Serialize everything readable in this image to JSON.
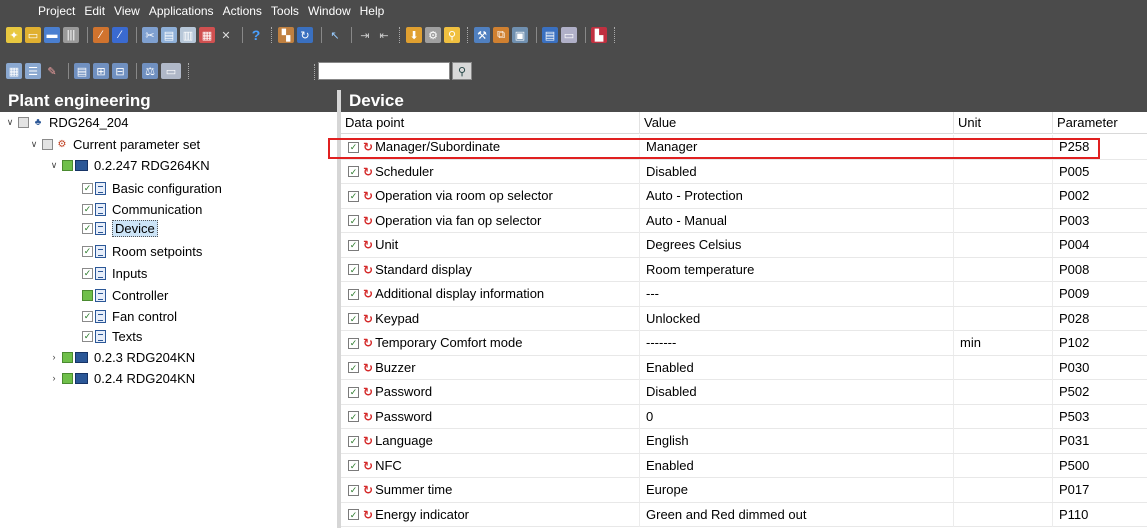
{
  "menu": [
    "Project",
    "Edit",
    "View",
    "Applications",
    "Actions",
    "Tools",
    "Window",
    "Help"
  ],
  "toolbar": {
    "search_value": "",
    "row1_icons": [
      "new-project-icon",
      "open-project-icon",
      "save-icon",
      "print-icon",
      "wand-icon",
      "edit-icon",
      "cut-icon",
      "copy-icon",
      "paste-icon",
      "paste-special-icon",
      "delete-icon",
      "help-icon",
      "view-icon",
      "refresh-icon",
      "connect-icon",
      "export-icon",
      "import-icon",
      "download-icon",
      "settings-icon",
      "search-icon",
      "tools-icon",
      "network-icon",
      "device-icon",
      "report-icon",
      "list-icon",
      "monitor-icon"
    ],
    "row2_icons": [
      "grid-icon",
      "list-view-icon",
      "pen-icon",
      "align-icon",
      "tree-icon",
      "hierarchy-icon",
      "scale-icon",
      "zone-icon"
    ],
    "search_icon": "magnifier-icon"
  },
  "left_pane": {
    "title": "Plant engineering",
    "tree": [
      {
        "label": "RDG264_204",
        "level": 0,
        "expanded": true,
        "icon": "plant-icon"
      },
      {
        "label": "Current parameter set",
        "level": 1,
        "expanded": true,
        "icon": "parameter-set-icon"
      },
      {
        "label": "0.2.247  RDG264KN",
        "level": 2,
        "expanded": true,
        "icon": "device-icon"
      },
      {
        "label": "Basic configuration",
        "level": 3,
        "icon": "page-icon"
      },
      {
        "label": "Communication",
        "level": 3,
        "icon": "page-icon"
      },
      {
        "label": "Device",
        "level": 3,
        "icon": "page-icon",
        "selected": true
      },
      {
        "label": "Room setpoints",
        "level": 3,
        "icon": "page-icon"
      },
      {
        "label": "Inputs",
        "level": 3,
        "icon": "page-icon"
      },
      {
        "label": "Controller",
        "level": 3,
        "icon": "page-icon"
      },
      {
        "label": "Fan control",
        "level": 3,
        "icon": "page-icon"
      },
      {
        "label": "Texts",
        "level": 3,
        "icon": "page-icon"
      },
      {
        "label": "0.2.3  RDG204KN",
        "level": 1,
        "expanded": false,
        "icon": "device-icon"
      },
      {
        "label": "0.2.4  RDG204KN",
        "level": 1,
        "expanded": false,
        "icon": "device-icon"
      }
    ]
  },
  "right_pane": {
    "title": "Device",
    "columns": [
      "Data point",
      "Value",
      "Unit",
      "Parameter"
    ],
    "rows": [
      {
        "data_point": "Manager/Subordinate",
        "value": "Manager",
        "unit": "",
        "parameter": "P258"
      },
      {
        "data_point": "Scheduler",
        "value": "Disabled",
        "unit": "",
        "parameter": "P005"
      },
      {
        "data_point": "Operation via room op selector",
        "value": "Auto - Protection",
        "unit": "",
        "parameter": "P002"
      },
      {
        "data_point": "Operation via fan op selector",
        "value": "Auto - Manual",
        "unit": "",
        "parameter": "P003"
      },
      {
        "data_point": "Unit",
        "value": "Degrees Celsius",
        "unit": "",
        "parameter": "P004"
      },
      {
        "data_point": "Standard display",
        "value": "Room temperature",
        "unit": "",
        "parameter": "P008"
      },
      {
        "data_point": "Additional display information",
        "value": "---",
        "unit": "",
        "parameter": "P009"
      },
      {
        "data_point": "Keypad",
        "value": "Unlocked",
        "unit": "",
        "parameter": "P028"
      },
      {
        "data_point": "Temporary Comfort mode",
        "value": "-------",
        "unit": "min",
        "parameter": "P102"
      },
      {
        "data_point": "Buzzer",
        "value": "Enabled",
        "unit": "",
        "parameter": "P030"
      },
      {
        "data_point": "Password",
        "value": "Disabled",
        "unit": "",
        "parameter": "P502"
      },
      {
        "data_point": "Password",
        "value": "0",
        "unit": "",
        "parameter": "P503"
      },
      {
        "data_point": "Language",
        "value": "English",
        "unit": "",
        "parameter": "P031"
      },
      {
        "data_point": "NFC",
        "value": "Enabled",
        "unit": "",
        "parameter": "P500"
      },
      {
        "data_point": "Summer time",
        "value": "Europe",
        "unit": "",
        "parameter": "P017"
      },
      {
        "data_point": "Energy indicator",
        "value": "Green and Red dimmed out",
        "unit": "",
        "parameter": "P110"
      }
    ]
  },
  "colors": {
    "chrome": "#4b4b4b",
    "highlight_box": "#e02020",
    "selection": "#cce4f7"
  }
}
